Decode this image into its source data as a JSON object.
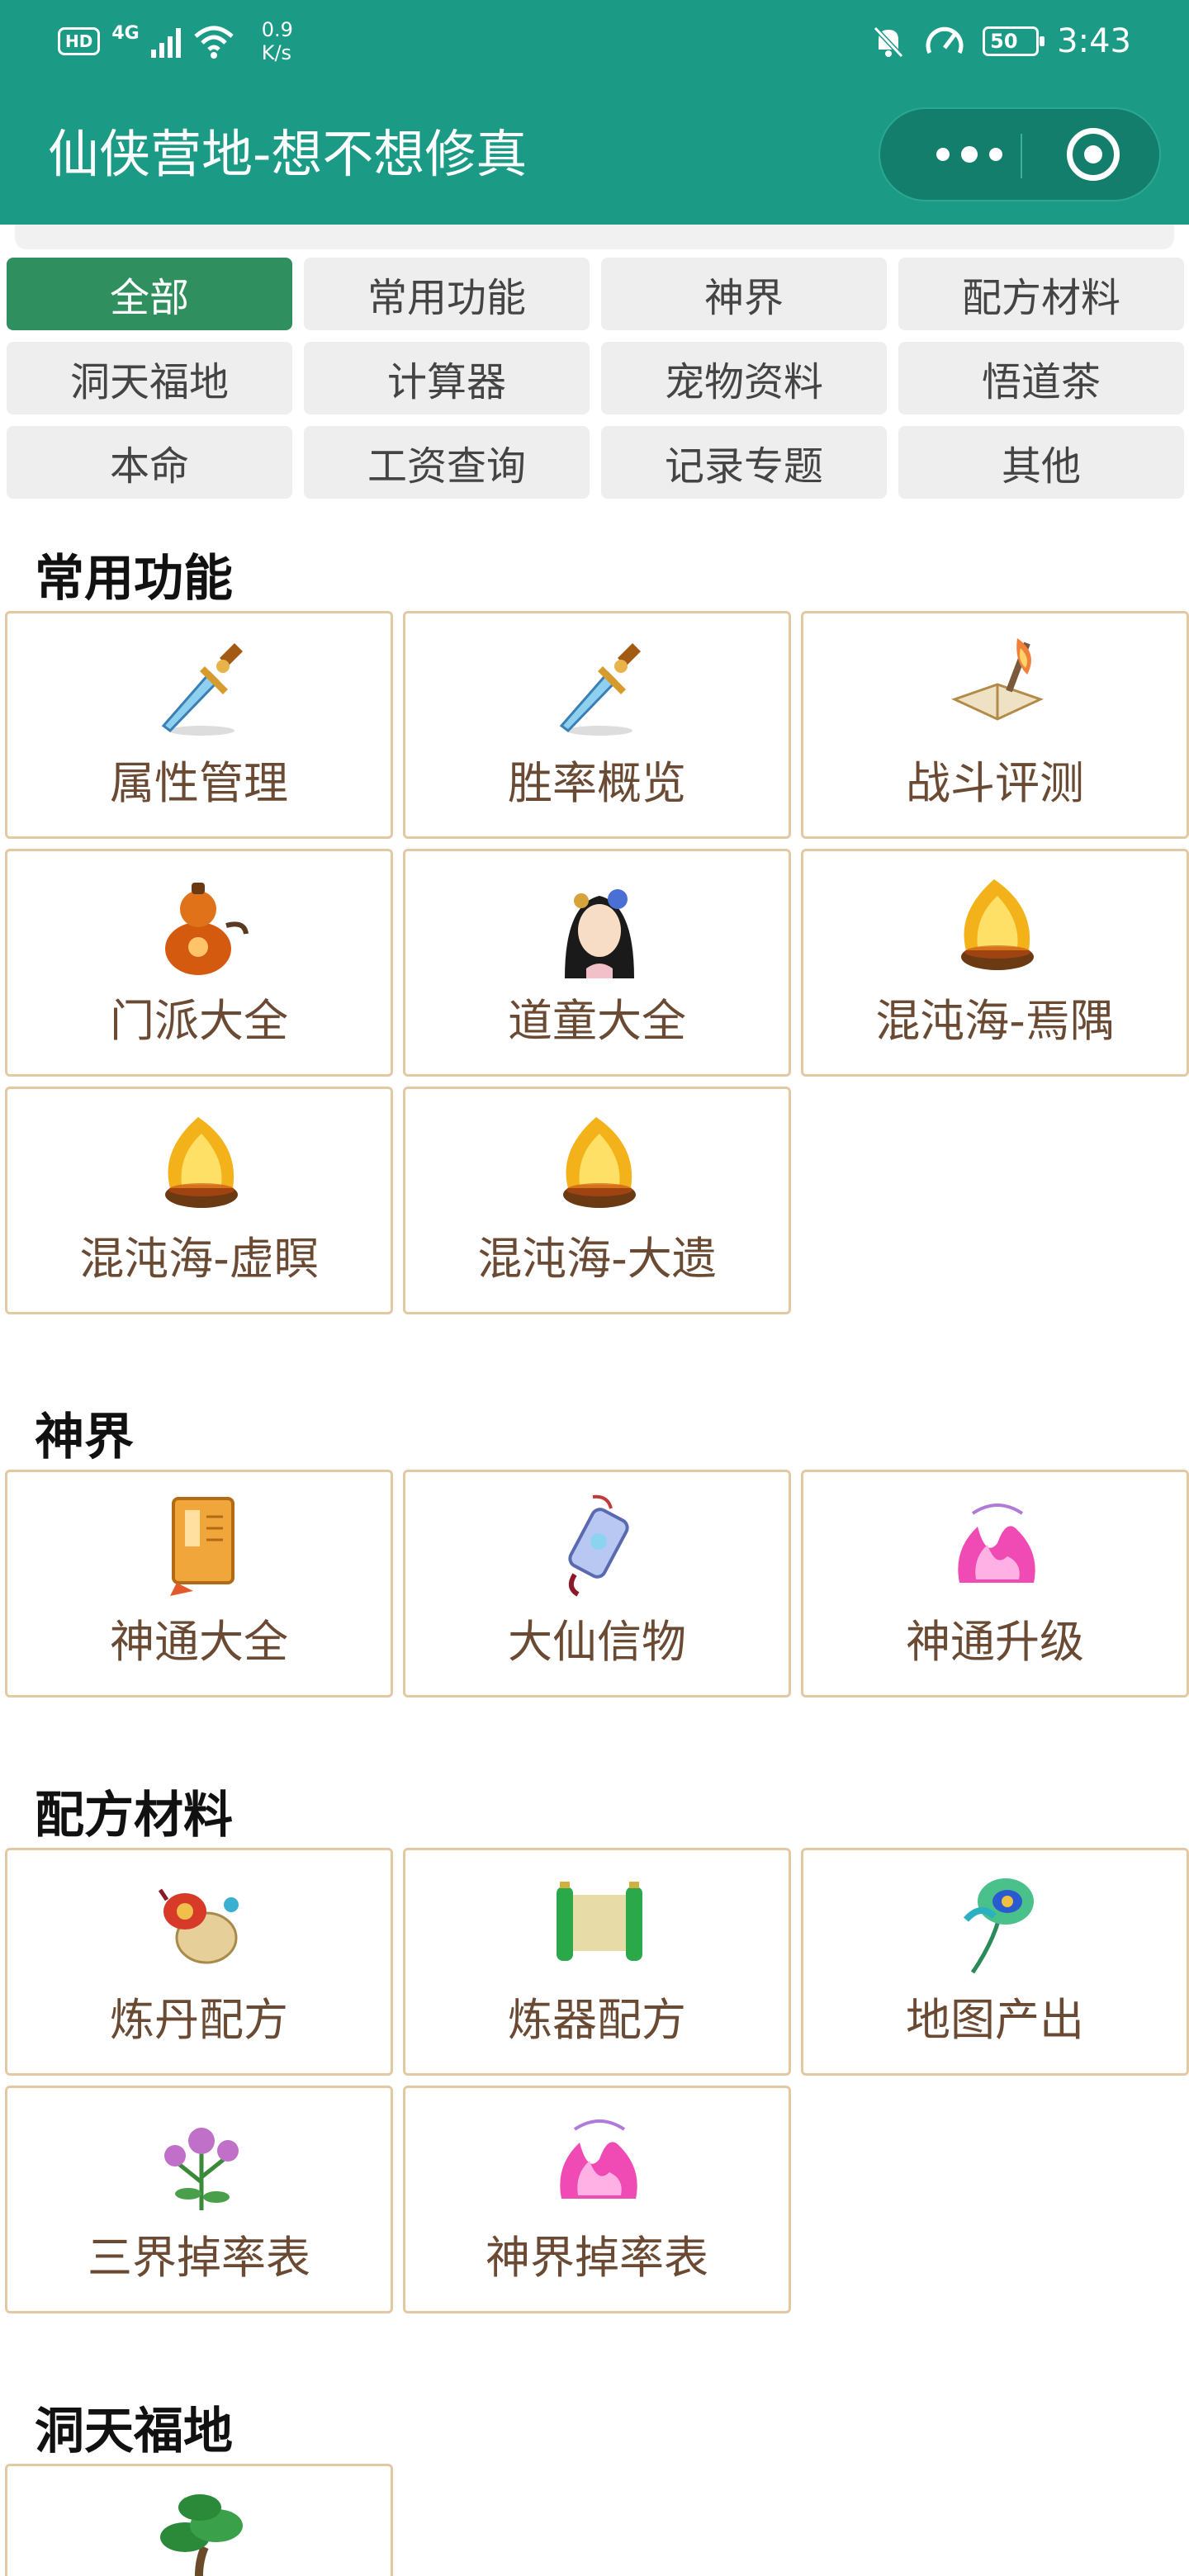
{
  "status_bar": {
    "hd": "HD",
    "network": "4G",
    "speed_value": "0.9",
    "speed_unit": "K/s",
    "battery": "50",
    "time": "3:43"
  },
  "header": {
    "title": "仙侠营地-想不想修真",
    "more_icon": "more-dots-icon",
    "close_icon": "target-circle-icon"
  },
  "tabs": [
    {
      "label": "全部",
      "active": true
    },
    {
      "label": "常用功能",
      "active": false
    },
    {
      "label": "神界",
      "active": false
    },
    {
      "label": "配方材料",
      "active": false
    },
    {
      "label": "洞天福地",
      "active": false
    },
    {
      "label": "计算器",
      "active": false
    },
    {
      "label": "宠物资料",
      "active": false
    },
    {
      "label": "悟道茶",
      "active": false
    },
    {
      "label": "本命",
      "active": false
    },
    {
      "label": "工资查询",
      "active": false
    },
    {
      "label": "记录专题",
      "active": false
    },
    {
      "label": "其他",
      "active": false
    }
  ],
  "sections": [
    {
      "title": "常用功能",
      "items": [
        {
          "label": "属性管理",
          "icon": "sword-icon"
        },
        {
          "label": "胜率概览",
          "icon": "sword-icon"
        },
        {
          "label": "战斗评测",
          "icon": "book-fire-icon"
        },
        {
          "label": "门派大全",
          "icon": "gourd-icon"
        },
        {
          "label": "道童大全",
          "icon": "fairy-portrait-icon"
        },
        {
          "label": "混沌海-焉隅",
          "icon": "golden-flame-icon"
        },
        {
          "label": "混沌海-虚瞑",
          "icon": "golden-flame-icon"
        },
        {
          "label": "混沌海-大遗",
          "icon": "golden-flame-icon"
        }
      ]
    },
    {
      "title": "神界",
      "items": [
        {
          "label": "神通大全",
          "icon": "scroll-book-icon"
        },
        {
          "label": "大仙信物",
          "icon": "jade-token-icon"
        },
        {
          "label": "神通升级",
          "icon": "pink-flame-icon"
        }
      ]
    },
    {
      "title": "配方材料",
      "items": [
        {
          "label": "炼丹配方",
          "icon": "pill-gourd-icon"
        },
        {
          "label": "炼器配方",
          "icon": "green-scroll-icon"
        },
        {
          "label": "地图产出",
          "icon": "peacock-feather-icon"
        },
        {
          "label": "三界掉率表",
          "icon": "flower-herb-icon"
        },
        {
          "label": "神界掉率表",
          "icon": "pink-flame-icon"
        }
      ]
    },
    {
      "title": "洞天福地",
      "items": [
        {
          "label": "",
          "icon": "bonsai-tree-icon"
        }
      ]
    }
  ]
}
